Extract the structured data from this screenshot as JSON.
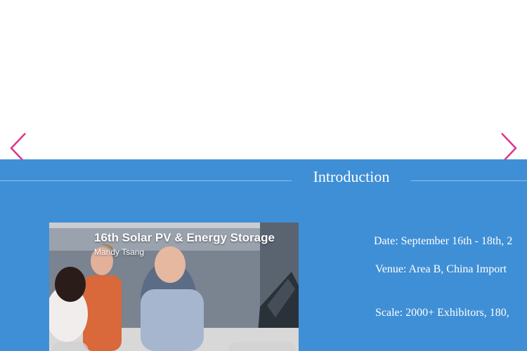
{
  "slider": {
    "prev_icon": "chevron-left-icon",
    "next_icon": "chevron-right-icon",
    "arrow_color": "#e0338c"
  },
  "introduction": {
    "title": "Introduction",
    "background_color": "#3f8fd6",
    "video": {
      "title": "16th Solar PV & Energy Storage",
      "author": "Mandy Tsang"
    },
    "date": "Date: September 16th - 18th, 2",
    "venue": "Venue: Area B, China Import",
    "scale": "Scale: 2000+ Exhibitors, 180,"
  }
}
